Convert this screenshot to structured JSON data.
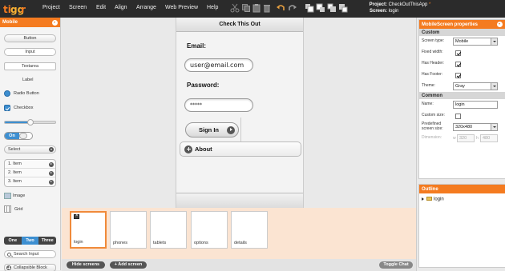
{
  "app": {
    "logo_text": "tiggr",
    "menu": [
      "Project",
      "Screen",
      "Edit",
      "Align",
      "Arrange",
      "Web Preview",
      "Help"
    ],
    "project_label": "Project:",
    "project_name": "CheckOutThisApp",
    "project_star": "*",
    "screen_label": "Screen:",
    "screen_name": "login",
    "toolbar_icons": [
      "cut-icon",
      "copy-icon",
      "paste-icon",
      "delete-icon",
      "undo-icon",
      "redo-icon",
      "bring-front-icon",
      "bring-forward-icon",
      "send-backward-icon",
      "send-back-icon"
    ]
  },
  "palette": {
    "title": "Mobile",
    "button": "Button",
    "input": "Input",
    "textarea": "Textarea",
    "label": "Label",
    "radio": "Radio Button",
    "checkbox": "Checkbox",
    "slider_value": 0.5,
    "toggle_on": "On",
    "select": "Select",
    "list_items": [
      "1. Item",
      "2. Item",
      "3. Item"
    ],
    "image": "Image",
    "grid": "Grid",
    "navbar": [
      "One",
      "Two",
      "Three"
    ],
    "navbar_active": "Two",
    "search": "Search Input",
    "collapsible": "Collapsible Block"
  },
  "canvas": {
    "header_title": "Check This Out",
    "email_label": "Email:",
    "email_value": "user@email.com",
    "password_label": "Password:",
    "password_value": "*****",
    "signin_button": "Sign In",
    "about_button": "About"
  },
  "screens": {
    "items": [
      "login",
      "phones",
      "tablets",
      "options",
      "details"
    ],
    "active": "login",
    "hide_screens": "Hide screens",
    "add_screen": "+ Add screen",
    "toggle_chat": "Toggle Chat"
  },
  "properties": {
    "title": "MobileScreen properties",
    "custom_section": "Custom",
    "screen_type_label": "Screen type:",
    "screen_type_value": "Mobile",
    "fixed_width_label": "Fixed width:",
    "has_header_label": "Has Header:",
    "has_footer_label": "Has Footer:",
    "theme_label": "Theme:",
    "theme_value": "Gray",
    "common_section": "Common",
    "name_label": "Name:",
    "name_value": "login",
    "custom_size_label": "Custom size:",
    "predefined_label": "Predefined screen size:",
    "predefined_value": "320x480",
    "dimension_label": "Dimension:",
    "dim_w_label": "w",
    "dim_w_value": "320",
    "dim_h_label": "h",
    "dim_h_value": "480"
  },
  "outline": {
    "title": "Outline",
    "root": "login"
  },
  "colors": {
    "accent": "#f47b20",
    "menubar": "#2b2b2b",
    "blue": "#3d8fd1"
  }
}
